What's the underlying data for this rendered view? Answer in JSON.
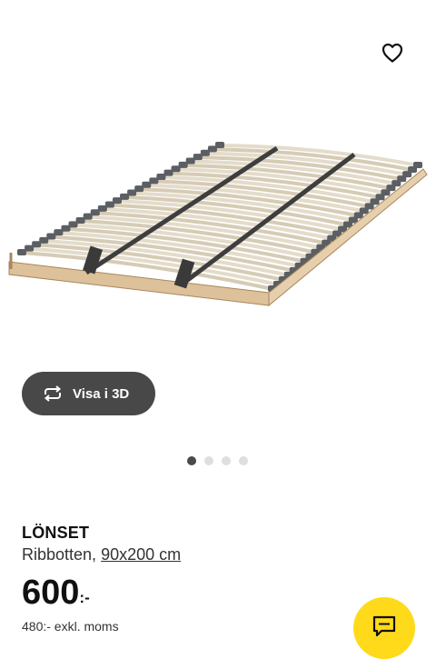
{
  "product": {
    "name": "LÖNSET",
    "type": "Ribbotten, ",
    "size": "90x200 cm",
    "price": "600",
    "price_suffix": ":-",
    "price_ex_vat": "480:- exkl. moms"
  },
  "gallery": {
    "view3d_label": "Visa i 3D",
    "image_count": 4,
    "active_index": 1
  },
  "icons": {
    "favorite": "heart-icon",
    "view3d": "rotate-icon",
    "chat": "chat-icon"
  },
  "colors": {
    "chat_button": "#ffda1a",
    "view3d_button": "#484848",
    "active_dot": "#4a4a4a",
    "inactive_dot": "#dfdfdf"
  }
}
